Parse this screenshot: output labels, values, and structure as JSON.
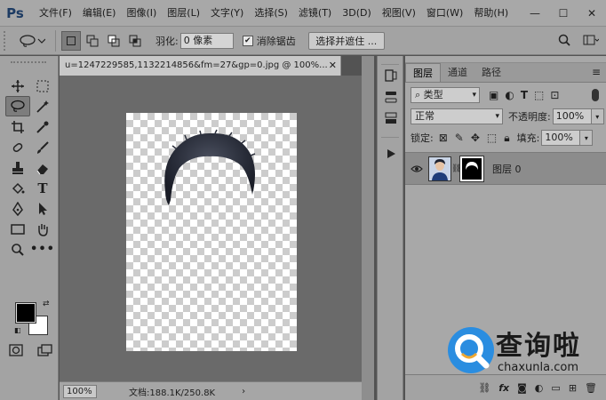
{
  "app": {
    "logo": "Ps"
  },
  "menu": [
    "文件(F)",
    "编辑(E)",
    "图像(I)",
    "图层(L)",
    "文字(Y)",
    "选择(S)",
    "滤镜(T)",
    "3D(D)",
    "视图(V)",
    "窗口(W)",
    "帮助(H)"
  ],
  "window_controls": {
    "minimize": "—",
    "maximize": "☐",
    "close": "✕"
  },
  "options": {
    "feather_label": "羽化:",
    "feather_value": "0 像素",
    "antialias_label": "消除锯齿",
    "antialias_checked": true,
    "select_mask_button": "选择并遮住 ..."
  },
  "document": {
    "tab_title": "u=1247229585,1132214856&fm=27&gp=0.jpg @ 100%...",
    "zoom": "100%",
    "doc_info": "文档:188.1K/250.8K"
  },
  "layers_panel": {
    "tabs": [
      "图层",
      "通道",
      "路径"
    ],
    "active_tab": 0,
    "filter_kind": "类型",
    "blend_mode": "正常",
    "opacity_label": "不透明度:",
    "opacity": "100%",
    "lock_label": "锁定:",
    "fill_label": "填充:",
    "fill": "100%",
    "layers": [
      {
        "name": "图层 0",
        "visible": true,
        "has_mask": true
      }
    ],
    "bottom_icons": [
      "link-icon",
      "fx-icon",
      "mask-icon",
      "adjustment-icon",
      "group-icon",
      "new-layer-icon",
      "trash-icon"
    ]
  },
  "watermark": {
    "chinese": "查询啦",
    "domain": "chaxunla.com"
  },
  "colors": {
    "foreground": "#000000",
    "background": "#ffffff",
    "accent": "#2a8de0"
  }
}
